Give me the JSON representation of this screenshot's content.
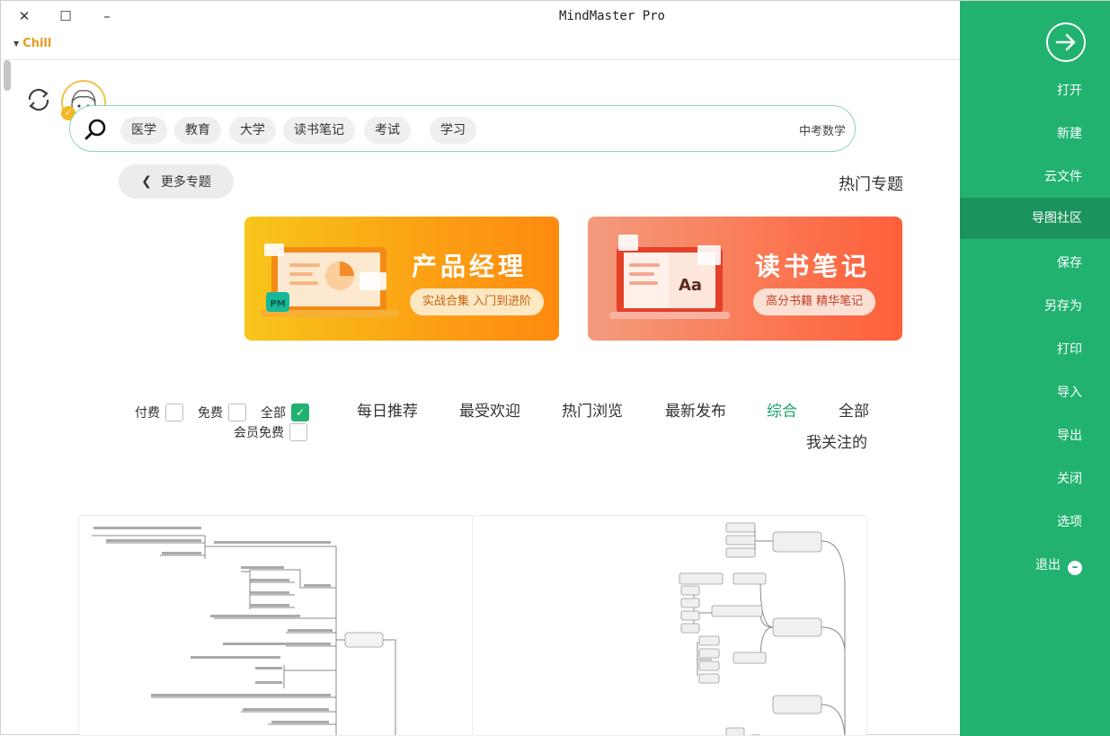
{
  "window": {
    "title": "MindMaster Pro",
    "close_glyph": "✕",
    "maximize_glyph": "☐",
    "minimize_glyph": "–",
    "theme_label": "Chill"
  },
  "search": {
    "tags": [
      "学习",
      "考试",
      "读书笔记",
      "大学",
      "教育",
      "医学"
    ],
    "value": "中考数学"
  },
  "topics": {
    "more_label": "更多专题",
    "hot_title": "热门专题"
  },
  "banners": [
    {
      "title": "产品经理",
      "subtitle": "实战合集 入门到进阶",
      "badge": "PM"
    },
    {
      "title": "读书笔记",
      "subtitle": "高分书籍 精华笔记",
      "badge": "Aa"
    }
  ],
  "filters": {
    "tabs": [
      "全部",
      "综合",
      "最新发布",
      "热门浏览",
      "最受欢迎",
      "每日推荐"
    ],
    "second_row_tab": "我关注的",
    "active_tab": "综合",
    "checkboxes": [
      {
        "label": "全部",
        "checked": true
      },
      {
        "label": "免费",
        "checked": false
      },
      {
        "label": "付费",
        "checked": false
      },
      {
        "label": "会员免费",
        "checked": false
      }
    ]
  },
  "sidebar": {
    "items": [
      "打开",
      "新建",
      "云文件",
      "导图社区",
      "保存",
      "另存为",
      "打印",
      "导入",
      "导出",
      "关闭",
      "选项",
      "退出"
    ],
    "active": "导图社区",
    "colors": {
      "bg": "#21b270",
      "active_bg": "#1a935c"
    }
  },
  "colors": {
    "accent": "#1aa167",
    "search_border": "#8fd6b3",
    "theme": "#e89a1c"
  }
}
